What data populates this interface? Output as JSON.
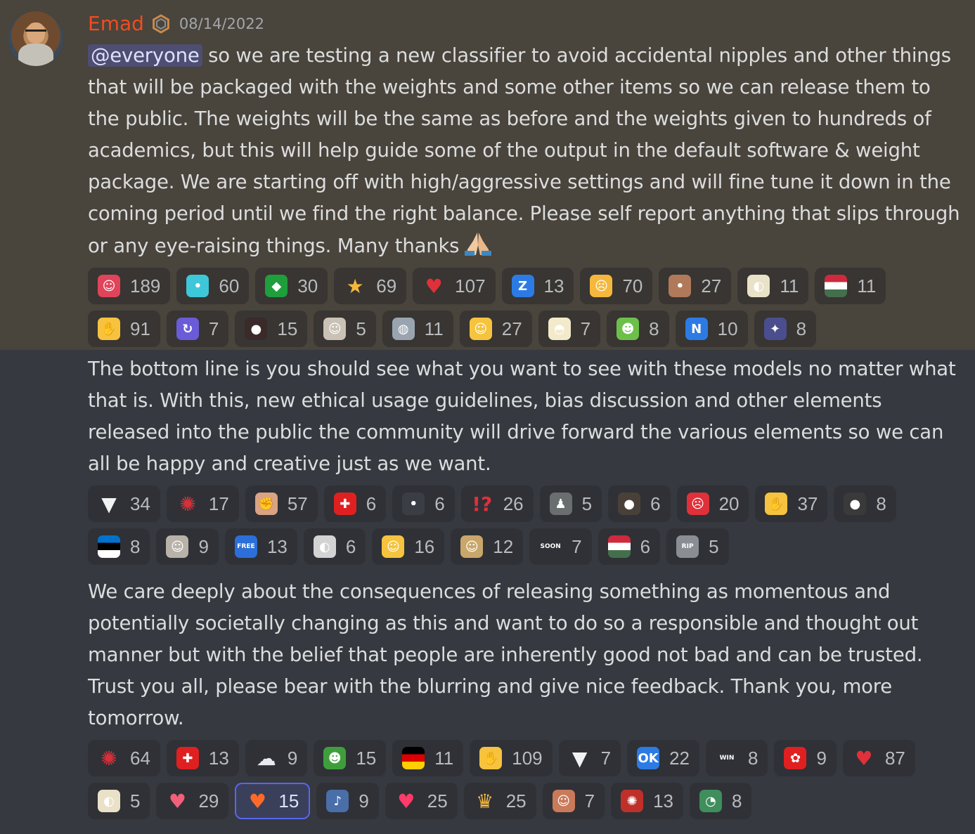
{
  "user": {
    "name": "Emad",
    "timestamp": "08/14/2022"
  },
  "messages": [
    {
      "mention": "@everyone",
      "text": " so we are testing a new classifier to avoid accidental nipples and other things that will be packaged with the weights and some other items so we can release them to the public. The weights will be the same as before and the weights given to hundreds of academics, but this will help guide some of the output in the default software & weight package. We are starting off with high/aggressive settings and will fine tune it down in the coming period until we find the right balance. Please self report anything that slips through or any eye-raising things. Many thanks",
      "reactions": [
        {
          "icon": "devil-face-icon",
          "glyph": "☺",
          "bg": "#e0445a",
          "count": "189"
        },
        {
          "icon": "cyan-blob-icon",
          "glyph": "•",
          "bg": "#3ec7d8",
          "count": "60"
        },
        {
          "icon": "brazil-flag-icon",
          "glyph": "◆",
          "bg": "#1f9e3c",
          "count": "30"
        },
        {
          "icon": "star-icon",
          "glyph": "★",
          "bg": "transparent",
          "count": "69"
        },
        {
          "icon": "heart-icon",
          "glyph": "♥",
          "bg": "transparent",
          "count": "107"
        },
        {
          "icon": "letter-z-icon",
          "glyph": "Z",
          "bg": "#2c7be5",
          "count": "13"
        },
        {
          "icon": "crying-face-icon",
          "glyph": "☹",
          "bg": "#f5b83d",
          "count": "70"
        },
        {
          "icon": "rock-face-icon",
          "glyph": "•",
          "bg": "#b07a5a",
          "count": "27"
        },
        {
          "icon": "goose-icon",
          "glyph": "◐",
          "bg": "#e9e2c8",
          "count": "11"
        },
        {
          "icon": "hungary-flag-icon",
          "glyph": "",
          "bg": "linear-gradient(#cd2a3e 0 33%,#fff 33% 66%,#436f4d 66%)",
          "count": "11"
        },
        {
          "icon": "thumbs-up-icon",
          "glyph": "✋",
          "bg": "#f7c33e",
          "count": "91"
        },
        {
          "icon": "swirl-icon",
          "glyph": "↻",
          "bg": "#6a5bd8",
          "count": "7"
        },
        {
          "icon": "dark-creature-icon",
          "glyph": "●",
          "bg": "#3a2a2a",
          "count": "15"
        },
        {
          "icon": "laughing-meme-icon",
          "glyph": "☺",
          "bg": "#c9c2b5",
          "count": "5"
        },
        {
          "icon": "armored-head-icon",
          "glyph": "◍",
          "bg": "#9aa4b0",
          "count": "11"
        },
        {
          "icon": "monocle-face-icon",
          "glyph": "☺",
          "bg": "#f5c33d",
          "count": "27"
        },
        {
          "icon": "cat-ghost-icon",
          "glyph": "◓",
          "bg": "#f3eacb",
          "count": "7"
        },
        {
          "icon": "pepe-icon",
          "glyph": "☻",
          "bg": "#6cc04a",
          "count": "8"
        },
        {
          "icon": "letter-n-icon",
          "glyph": "N",
          "bg": "#2c7be5",
          "count": "10"
        },
        {
          "icon": "wizard-icon",
          "glyph": "✦",
          "bg": "#4a4e8e",
          "count": "8"
        }
      ]
    },
    {
      "text": "The bottom line is you should see what you want to see with these models no matter what that is. With this, new ethical usage guidelines, bias discussion and other elements released into the public the community will drive forward the various elements so we can all be happy and creative just as we want.",
      "reactions": [
        {
          "icon": "tooth-icon",
          "glyph": "▼",
          "bg": "transparent",
          "count": "34"
        },
        {
          "icon": "crab-icon",
          "glyph": "✺",
          "bg": "transparent",
          "count": "17"
        },
        {
          "icon": "fist-icon",
          "glyph": "✊",
          "bg": "#d9a384",
          "count": "57"
        },
        {
          "icon": "swiss-flag-icon",
          "glyph": "✚",
          "bg": "#e02020",
          "count": "6"
        },
        {
          "icon": "dark-bird-icon",
          "glyph": "•",
          "bg": "#3a3d44",
          "count": "6"
        },
        {
          "icon": "interrobang-icon",
          "glyph": "!?",
          "bg": "transparent",
          "count": "26"
        },
        {
          "icon": "suited-man-icon",
          "glyph": "♟",
          "bg": "#6a6e6e",
          "count": "5"
        },
        {
          "icon": "bald-man-icon",
          "glyph": "●",
          "bg": "#4a403a",
          "count": "6"
        },
        {
          "icon": "angry-face-icon",
          "glyph": "☹",
          "bg": "#e0303a",
          "count": "20"
        },
        {
          "icon": "folded-hands-icon",
          "glyph": "✋",
          "bg": "#f5c33d",
          "count": "37"
        },
        {
          "icon": "hooded-man-icon",
          "glyph": "●",
          "bg": "#3a3a3a",
          "count": "8"
        },
        {
          "icon": "estonia-flag-icon",
          "glyph": "",
          "bg": "linear-gradient(#0072ce 0 33%,#000 33% 66%,#fff 66%)",
          "count": "8"
        },
        {
          "icon": "celebrity-face-icon",
          "glyph": "☺",
          "bg": "#b8b2a8",
          "count": "9"
        },
        {
          "icon": "free-badge-icon",
          "glyph": "FREE",
          "bg": "#2c6fd8",
          "count": "13"
        },
        {
          "icon": "gray-goose-icon",
          "glyph": "◐",
          "bg": "#d3d3d3",
          "count": "6"
        },
        {
          "icon": "flushed-face-icon",
          "glyph": "☺",
          "bg": "#f5c33d",
          "count": "16"
        },
        {
          "icon": "screaming-meme-icon",
          "glyph": "☺",
          "bg": "#c9a76a",
          "count": "12"
        },
        {
          "icon": "soon-badge-icon",
          "glyph": "SOON",
          "bg": "#2f3136",
          "count": "7"
        },
        {
          "icon": "hungary-flag-icon",
          "glyph": "",
          "bg": "linear-gradient(#cd2a3e 0 33%,#fff 33% 66%,#436f4d 66%)",
          "count": "6"
        },
        {
          "icon": "rip-tombstone-icon",
          "glyph": "RIP",
          "bg": "#8a8e94",
          "count": "5"
        }
      ]
    },
    {
      "text": "We care deeply about the consequences of releasing something as momentous and potentially societally changing as this and want to do so a responsible and thought out manner but with the belief that people are inherently good not bad and can be trusted. Trust you all, please bear with the blurring and give nice feedback. Thank you, more tomorrow.",
      "reactions": [
        {
          "icon": "crab-icon",
          "glyph": "✺",
          "bg": "transparent",
          "count": "64"
        },
        {
          "icon": "swiss-flag-icon",
          "glyph": "✚",
          "bg": "#e02020",
          "count": "13"
        },
        {
          "icon": "cloud-icon",
          "glyph": "☁",
          "bg": "transparent",
          "count": "9"
        },
        {
          "icon": "pepe-icon",
          "glyph": "☻",
          "bg": "#3f9e3c",
          "count": "15"
        },
        {
          "icon": "germany-flag-icon",
          "glyph": "",
          "bg": "linear-gradient(#000 0 33%,#dd0000 33% 66%,#ffce00 66%)",
          "count": "11"
        },
        {
          "icon": "thumbs-up-icon",
          "glyph": "✋",
          "bg": "#f7c33e",
          "count": "109"
        },
        {
          "icon": "tooth-icon",
          "glyph": "▼",
          "bg": "transparent",
          "count": "7"
        },
        {
          "icon": "ok-button-icon",
          "glyph": "OK",
          "bg": "#2c7be5",
          "count": "22"
        },
        {
          "icon": "win-badge-icon",
          "glyph": "WIN",
          "bg": "#2f3136",
          "count": "8"
        },
        {
          "icon": "canada-flag-icon",
          "glyph": "✿",
          "bg": "#e02020",
          "count": "9"
        },
        {
          "icon": "heart-icon",
          "glyph": "♥",
          "bg": "transparent",
          "count": "87"
        },
        {
          "icon": "goose-icon",
          "glyph": "◐",
          "bg": "#e9e2c8",
          "count": "5"
        },
        {
          "icon": "heartbeat-icon",
          "glyph": "♥",
          "bg": "transparent",
          "count": "29"
        },
        {
          "icon": "fire-heart-icon",
          "glyph": "♥",
          "bg": "transparent",
          "count": "15",
          "me": true
        },
        {
          "icon": "rapper-icon",
          "glyph": "♪",
          "bg": "#4a6ea8",
          "count": "9"
        },
        {
          "icon": "sparkling-heart-icon",
          "glyph": "♥",
          "bg": "transparent",
          "count": "25"
        },
        {
          "icon": "trophy-icon",
          "glyph": "♛",
          "bg": "transparent",
          "count": "25"
        },
        {
          "icon": "face-photo-icon",
          "glyph": "☺",
          "bg": "#c97a5a",
          "count": "7"
        },
        {
          "icon": "red-crab-icon",
          "glyph": "✺",
          "bg": "#c0302a",
          "count": "13"
        },
        {
          "icon": "frog-icon",
          "glyph": "◔",
          "bg": "#3f8e5c",
          "count": "8"
        }
      ]
    }
  ],
  "colors": {
    "background": "#36393f",
    "mentioned_background": "#49443c",
    "username": "#f04d20",
    "reaction_background": "#2f3136",
    "reaction_selected_border": "#5865f2"
  }
}
